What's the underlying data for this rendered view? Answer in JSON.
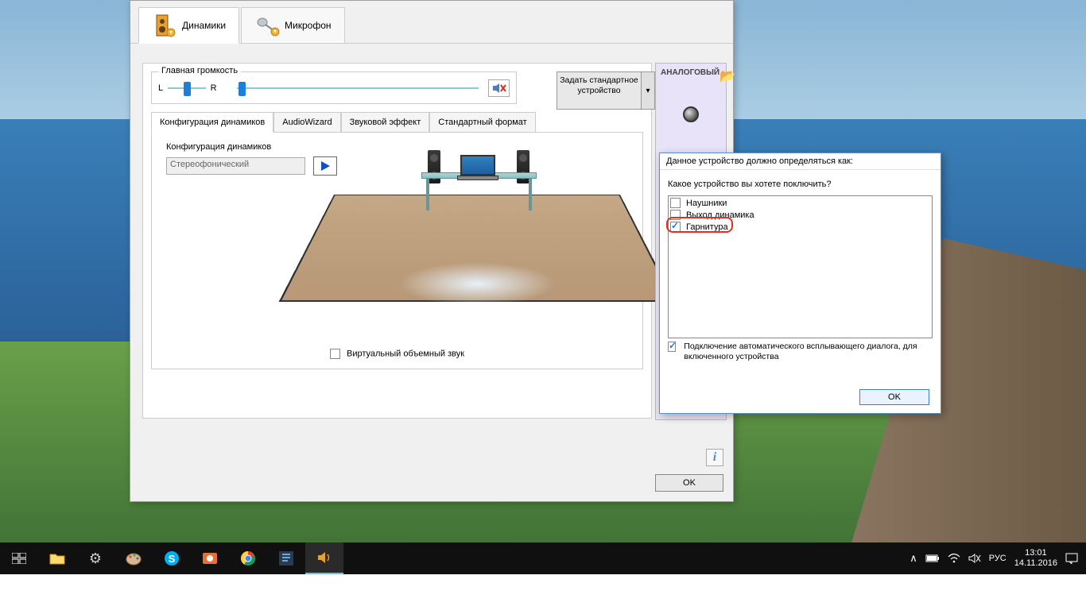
{
  "tabs": {
    "speakers": "Динамики",
    "mic": "Микрофон"
  },
  "volume": {
    "group_title": "Главная громкость",
    "left": "L",
    "right": "R"
  },
  "default_device": {
    "label": "Задать стандартное устройство"
  },
  "config_tabs": {
    "speaker_config": "Конфигурация динамиков",
    "audio_wizard": "AudioWizard",
    "sound_effect": "Звуковой эффект",
    "default_format": "Стандартный формат"
  },
  "speaker_config": {
    "label": "Конфигурация динамиков",
    "select_value": "Стереофонический",
    "virtual_surround": "Виртуальный объемный звук"
  },
  "right_panel": {
    "title": "АНАЛОГОВЫЙ"
  },
  "buttons": {
    "ok": "OK"
  },
  "dialog": {
    "title": "Данное устройство должно определяться как:",
    "question": "Какое устройство вы хотете поключить?",
    "options": {
      "headphones": "Наушники",
      "speaker_out": "Выход динамика",
      "headset": "Гарнитура"
    },
    "auto_popup": "Подключение автоматического всплывающего диалога, для включенного устройства",
    "ok": "OK"
  },
  "taskbar": {
    "lang": "РУС",
    "time": "13:01",
    "date": "14.11.2016"
  }
}
